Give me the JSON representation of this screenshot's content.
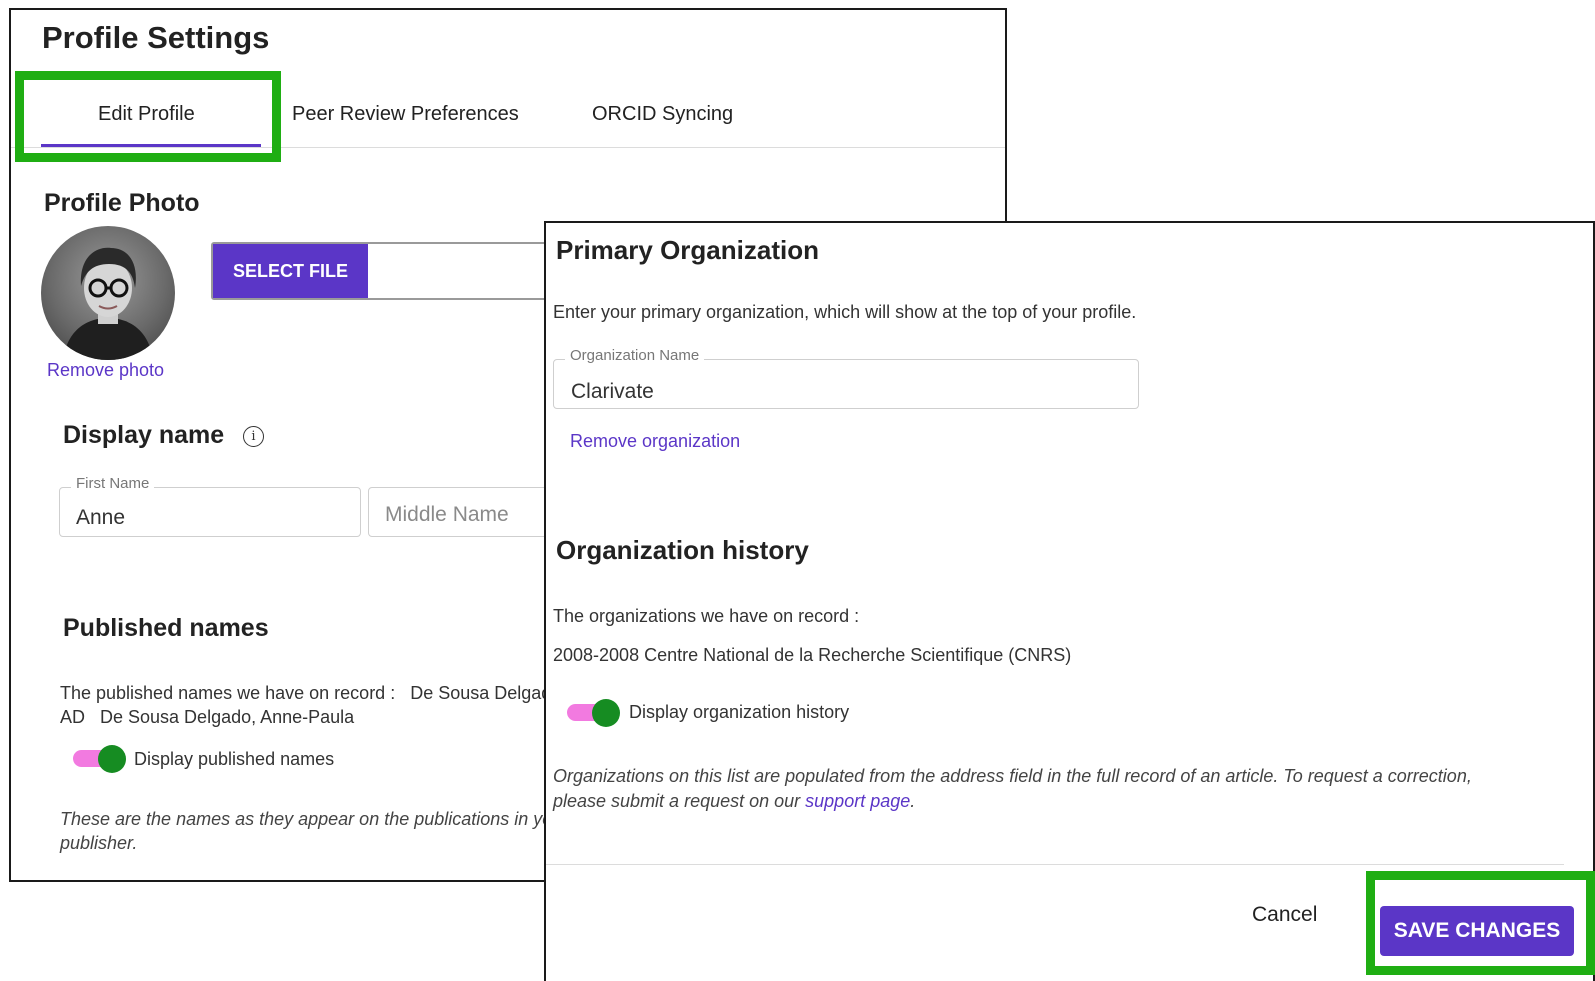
{
  "page": {
    "title": "Profile Settings"
  },
  "tabs": [
    {
      "label": "Edit Profile",
      "active": true
    },
    {
      "label": "Peer Review Preferences",
      "active": false
    },
    {
      "label": "ORCID Syncing",
      "active": false
    }
  ],
  "profile_photo": {
    "title": "Profile Photo",
    "select_file_label": "SELECT FILE",
    "remove_photo_label": "Remove photo"
  },
  "display_name": {
    "title": "Display name",
    "first_name_label": "First Name",
    "first_name_value": "Anne",
    "middle_name_placeholder": "Middle Name"
  },
  "published_names": {
    "title": "Published names",
    "record_line_1": "The published names we have on record :   De Sousa Delgado",
    "record_line_2": "AD   De Sousa Delgado, Anne-Paula",
    "toggle_label": "Display published names",
    "toggle_on": true,
    "note_line_1": "These are the names as they appear on the publications in you",
    "note_line_2": "publisher."
  },
  "primary_org": {
    "title": "Primary Organization",
    "description": "Enter your primary organization, which will show at the top of your profile.",
    "field_label": "Organization Name",
    "field_value": "Clarivate",
    "remove_label": "Remove organization"
  },
  "org_history": {
    "title": "Organization history",
    "record_intro": "The organizations we have on record :",
    "record_entry": "2008-2008 Centre National de la Recherche Scientifique (CNRS)",
    "toggle_label": "Display organization history",
    "toggle_on": true,
    "note_line_1": "Organizations on this list are populated from the address field in the full record of an article. To request a correction,",
    "note_line_2_prefix": "please submit a request on our ",
    "note_link": "support page",
    "note_line_2_suffix": "."
  },
  "actions": {
    "cancel_label": "Cancel",
    "save_label": "SAVE CHANGES"
  },
  "colors": {
    "accent": "#5b36c7",
    "highlight": "#1fae13",
    "toggle_track": "#f27ae0",
    "toggle_knob": "#168c22"
  }
}
